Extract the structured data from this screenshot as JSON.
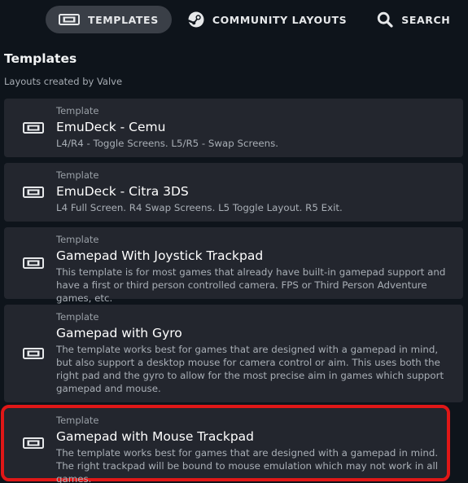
{
  "tabs": [
    {
      "label": "TEMPLATES",
      "icon": "controller-layout-icon",
      "active": true
    },
    {
      "label": "COMMUNITY LAYOUTS",
      "icon": "steam-icon",
      "active": false
    },
    {
      "label": "SEARCH",
      "icon": "search-icon",
      "active": false
    }
  ],
  "section": {
    "title": "Templates",
    "subtitle": "Layouts created by Valve"
  },
  "templates": [
    {
      "kind": "Template",
      "name": "EmuDeck - Cemu",
      "description": "L4/R4 - Toggle Screens. L5/R5 - Swap Screens.",
      "icon": "controller-layout-icon"
    },
    {
      "kind": "Template",
      "name": "EmuDeck - Citra 3DS",
      "description": "L4 Full Screen. R4 Swap Screens. L5 Toggle Layout. R5 Exit.",
      "icon": "controller-layout-icon"
    },
    {
      "kind": "Template",
      "name": "Gamepad With Joystick Trackpad",
      "description": "This template is for most games that already have built-in gamepad support and have a first or third person controlled camera. FPS or Third Person Adventure games, etc.",
      "icon": "controller-layout-icon"
    },
    {
      "kind": "Template",
      "name": "Gamepad with Gyro",
      "description": "The template works best for games that are designed with a gamepad in mind, but also support a desktop mouse for camera control or aim. This uses both the right pad and the gyro to allow for the most precise aim in games which support gamepad and mouse.",
      "icon": "controller-layout-icon"
    },
    {
      "kind": "Template",
      "name": "Gamepad with Mouse Trackpad",
      "description": "The template works best for games that are designed with a gamepad in mind. The right trackpad will be bound to mouse emulation which may not work in all games.",
      "icon": "controller-layout-icon",
      "highlighted": true
    }
  ],
  "colors": {
    "background": "#0e141b",
    "card": "#23262e",
    "active_tab": "#3a3f47",
    "highlight_outline": "#e01717"
  }
}
